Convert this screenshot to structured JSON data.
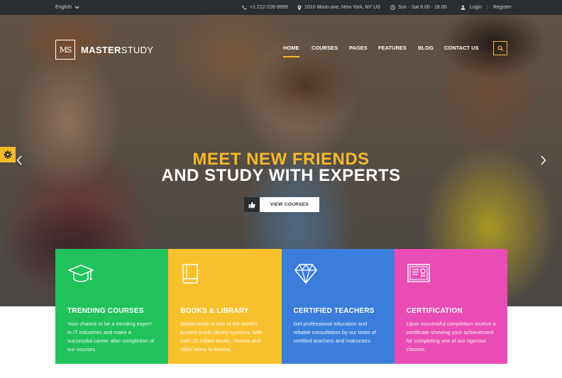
{
  "topbar": {
    "language": "English",
    "phone": "+1 212-226-9999",
    "address": "1010 Moon ave, New York, NY US",
    "hours": "Sun - Sat 8.00 - 18.00",
    "login": "Login",
    "separator": "|",
    "register": "Register",
    "icons": [
      "chevron-down-icon",
      "phone-icon",
      "map-pin-icon",
      "clock-icon",
      "user-icon"
    ]
  },
  "logo": {
    "monogram": "MS",
    "name_bold": "MASTER",
    "name_light": "STUDY"
  },
  "nav": {
    "items": [
      "HOME",
      "COURSES",
      "PAGES",
      "FEATURES",
      "BLOG",
      "CONTACT US"
    ],
    "active": "HOME"
  },
  "hero": {
    "headline_line1": "MEET NEW FRIENDS",
    "headline_line2": "AND STUDY WITH EXPERTS",
    "cta_label": "VIEW COURSES",
    "cta_icon": "thumbs-up-icon"
  },
  "features": [
    {
      "title": "TRENDING COURSES",
      "text": "Your chance to be a trending expert in IT industries and make a successful career after completion of our courses.",
      "icon": "graduation-cap-icon",
      "color": "#21c25b"
    },
    {
      "title": "BOOKS & LIBRARY",
      "text": "Masterstudy is one of the world's busiest public library systems, with over 10 million books, movies and other items to borrow.",
      "icon": "book-icon",
      "color": "#f9c02d"
    },
    {
      "title": "CERTIFIED TEACHERS",
      "text": "Get professional education and reliable consultation by our team of certified teachers and instructors.",
      "icon": "diamond-icon",
      "color": "#3a7ddb"
    },
    {
      "title": "CERTIFICATION",
      "text": "Upon successful completion receive a certificate showing your achievement for completing one of our rigorous classes.",
      "icon": "certificate-icon",
      "color": "#e94cb4"
    }
  ],
  "colors": {
    "accent": "#f4b82b",
    "topbar_bg": "#2b2e31"
  }
}
